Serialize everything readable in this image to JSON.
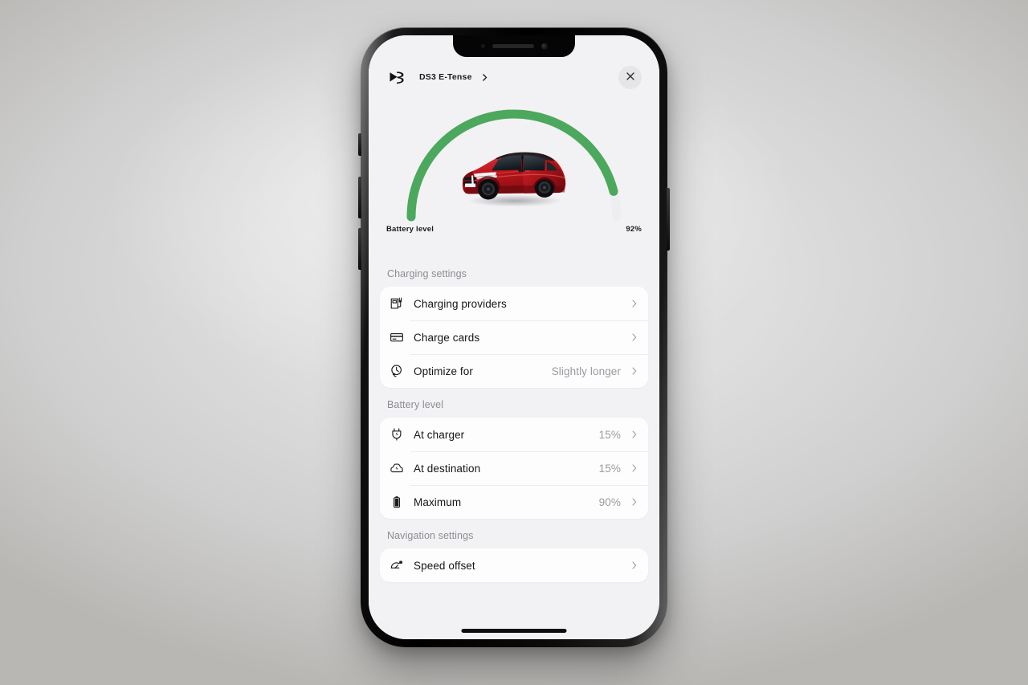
{
  "background": {
    "surface_color": "#dedede",
    "vignette_color": "#b9b7b4"
  },
  "device": {
    "frame_color": "#000000",
    "screen_background": "#f2f2f5",
    "buttons": [
      {
        "name": "silent-switch"
      },
      {
        "name": "volume-up"
      },
      {
        "name": "volume-down"
      },
      {
        "name": "power"
      }
    ]
  },
  "header": {
    "brand_icon": "ds-logo-icon",
    "vehicle_name": "DS3 E-Tense",
    "chevron_icon": "chevron-right-icon",
    "close_icon": "close-icon"
  },
  "gauge": {
    "label": "Battery level",
    "value_text": "92%",
    "percent": 92,
    "arc_color": "#4ca85c",
    "track_color": "#f2f2f5",
    "vehicle_image_alt": "red-ds3-crossover"
  },
  "sections": [
    {
      "title": "Charging settings",
      "rows": [
        {
          "icon": "charging-station-icon",
          "label": "Charging providers",
          "value": "",
          "chevron": "chevron-right-icon"
        },
        {
          "icon": "credit-card-icon",
          "label": "Charge cards",
          "value": "",
          "chevron": "chevron-right-icon"
        },
        {
          "icon": "clock-plug-icon",
          "label": "Optimize for",
          "value": "Slightly longer",
          "chevron": "chevron-right-icon"
        }
      ]
    },
    {
      "title": "Battery level",
      "rows": [
        {
          "icon": "plug-bolt-icon",
          "label": "At charger",
          "value": "15%",
          "chevron": "chevron-right-icon"
        },
        {
          "icon": "car-bolt-icon",
          "label": "At destination",
          "value": "15%",
          "chevron": "chevron-right-icon"
        },
        {
          "icon": "battery-full-icon",
          "label": "Maximum",
          "value": "90%",
          "chevron": "chevron-right-icon"
        }
      ]
    },
    {
      "title": "Navigation settings",
      "rows": [
        {
          "icon": "speedometer-icon",
          "label": "Speed offset",
          "value": "",
          "chevron": "chevron-right-icon"
        }
      ]
    }
  ]
}
